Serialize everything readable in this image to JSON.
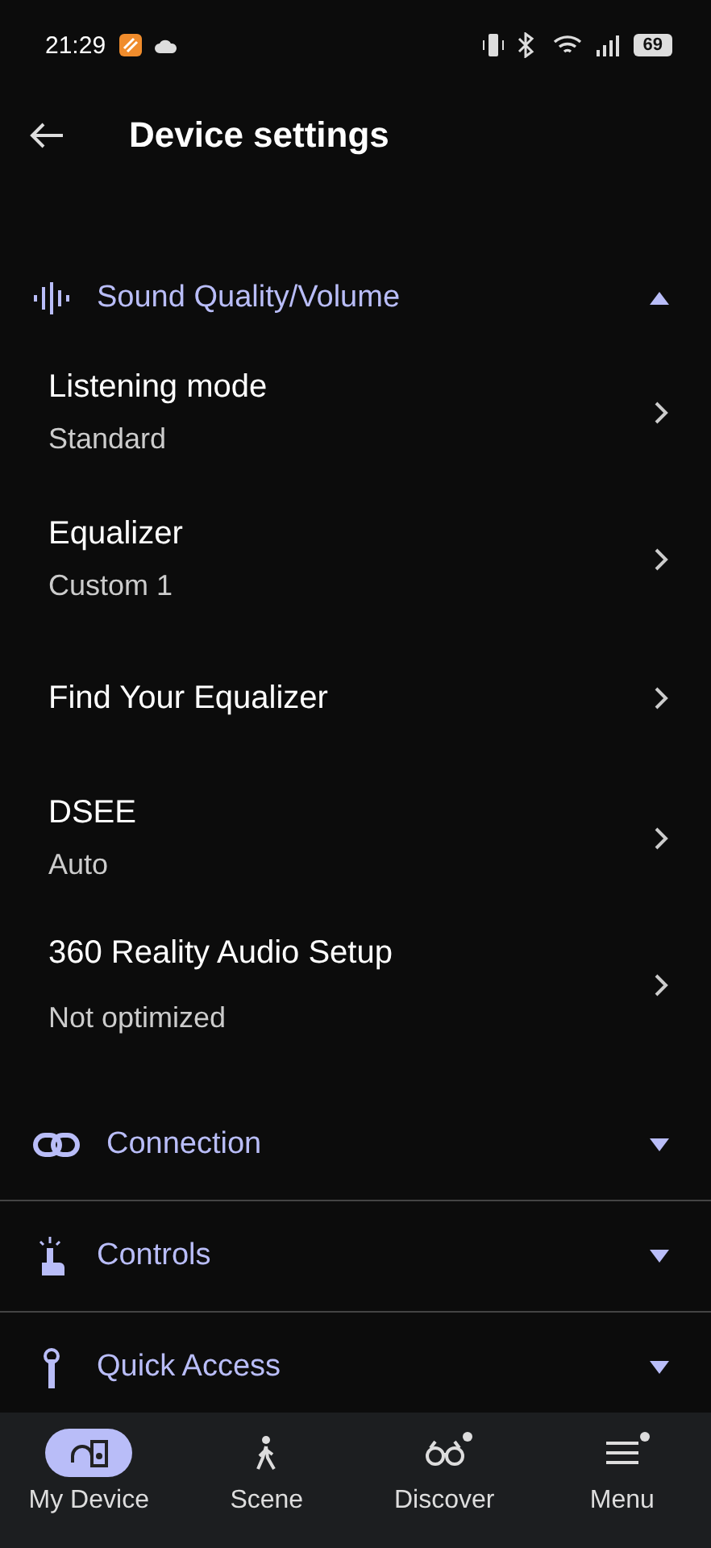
{
  "status_bar": {
    "time": "21:29",
    "battery": "69"
  },
  "header": {
    "title": "Device settings"
  },
  "sections": [
    {
      "title": "Sound Quality/Volume",
      "expanded": true,
      "items": [
        {
          "title": "Listening mode",
          "value": "Standard"
        },
        {
          "title": "Equalizer",
          "value": "Custom 1"
        },
        {
          "title": "Find Your Equalizer"
        },
        {
          "title": "DSEE",
          "value": "Auto"
        },
        {
          "title": "360 Reality Audio Setup",
          "value": "Not optimized"
        }
      ]
    },
    {
      "title": "Connection",
      "expanded": false
    },
    {
      "title": "Controls",
      "expanded": false
    },
    {
      "title": "Quick Access",
      "expanded": false
    }
  ],
  "bottom_nav": [
    {
      "label": "My Device",
      "selected": true,
      "badge": false
    },
    {
      "label": "Scene",
      "selected": false,
      "badge": false
    },
    {
      "label": "Discover",
      "selected": false,
      "badge": true
    },
    {
      "label": "Menu",
      "selected": false,
      "badge": true
    }
  ]
}
